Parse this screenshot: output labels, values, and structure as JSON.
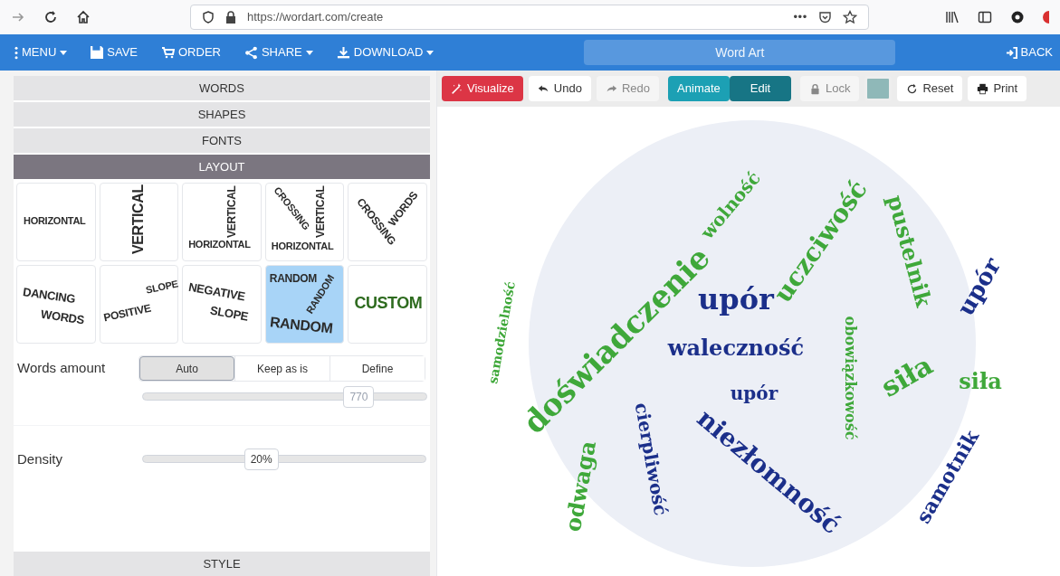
{
  "browser": {
    "url": "https://wordart.com/create",
    "more": "•••"
  },
  "nav": {
    "items": [
      {
        "label": "MENU",
        "caret": true
      },
      {
        "label": "SAVE",
        "caret": false
      },
      {
        "label": "ORDER",
        "caret": false
      },
      {
        "label": "SHARE",
        "caret": true
      },
      {
        "label": "DOWNLOAD",
        "caret": true
      }
    ],
    "title": "Word Art",
    "back": "BACK"
  },
  "sections": [
    {
      "label": "WORDS",
      "selected": false
    },
    {
      "label": "SHAPES",
      "selected": false
    },
    {
      "label": "FONTS",
      "selected": false
    },
    {
      "label": "LAYOUT",
      "selected": true
    }
  ],
  "layouts": [
    {
      "words": [
        "HORIZONTAL"
      ],
      "selected": false,
      "color": "#2b2b2b"
    },
    {
      "words": [
        "VERTICAL"
      ],
      "selected": false,
      "color": "#2b2b2b"
    },
    {
      "words": [
        "VERTICAL",
        "HORIZONTAL"
      ],
      "selected": false,
      "color": "#2b2b2b"
    },
    {
      "words": [
        "CROSSING",
        "VERTICAL",
        "HORIZONTAL"
      ],
      "selected": false,
      "color": "#2b2b2b"
    },
    {
      "words": [
        "CROSSING",
        "WORDS"
      ],
      "selected": false,
      "color": "#2b2b2b"
    },
    {
      "words": [
        "DANCING",
        "WORDS"
      ],
      "selected": false,
      "color": "#2b2b2b"
    },
    {
      "words": [
        "POSITIVE",
        "SLOPE"
      ],
      "selected": false,
      "color": "#2b2b2b"
    },
    {
      "words": [
        "NEGATIVE",
        "SLOPE"
      ],
      "selected": false,
      "color": "#2b2b2b"
    },
    {
      "words": [
        "RANDOM",
        "RANDOM",
        "RANDOM"
      ],
      "selected": true,
      "color": "#2b2b2b"
    },
    {
      "words": [
        "CUSTOM"
      ],
      "selected": false,
      "color": "#2e6b1f"
    }
  ],
  "words_amount": {
    "label": "Words amount",
    "options": [
      {
        "label": "Auto",
        "selected": true
      },
      {
        "label": "Keep as is",
        "selected": false
      },
      {
        "label": "Define",
        "selected": false
      }
    ],
    "slider": {
      "level": 0.76,
      "reading": "770",
      "disabled": true
    }
  },
  "density": {
    "label": "Density",
    "slider": {
      "level": 0.42,
      "reading": "20%",
      "disabled": false
    }
  },
  "style_section": {
    "label": "STYLE",
    "selected": false
  },
  "toolbar": [
    {
      "kind": "primary",
      "label": "Visualize"
    },
    {
      "kind": "plain",
      "label": "Undo",
      "disabled": false
    },
    {
      "kind": "plain",
      "label": "Redo",
      "disabled": true
    },
    {
      "kind": "toggle",
      "label": "Animate",
      "selected": false
    },
    {
      "kind": "toggle",
      "label": "Edit",
      "selected": true
    },
    {
      "kind": "plain",
      "label": "Lock",
      "disabled": true
    },
    {
      "kind": "swatch",
      "color": "#8fb8b8"
    },
    {
      "kind": "plain",
      "label": "Reset",
      "disabled": false
    },
    {
      "kind": "plain",
      "label": "Print",
      "disabled": false
    }
  ],
  "cloud_words": [
    {
      "text": "doświadczenie",
      "color": "#3fa83a"
    },
    {
      "text": "upór",
      "color": "#1b2f8a"
    },
    {
      "text": "waleczność",
      "color": "#1b2f8a"
    },
    {
      "text": "uczciwość",
      "color": "#3fa83a"
    },
    {
      "text": "pustelnik",
      "color": "#3fa83a"
    },
    {
      "text": "siła",
      "color": "#3fa83a"
    },
    {
      "text": "wolność",
      "color": "#3fa83a"
    },
    {
      "text": "niezłomność",
      "color": "#1b2f8a"
    },
    {
      "text": "cierpliwość",
      "color": "#1b2f8a"
    },
    {
      "text": "samotnik",
      "color": "#1b2f8a"
    },
    {
      "text": "odwaga",
      "color": "#3fa83a"
    },
    {
      "text": "obowiązkowość",
      "color": "#3fa83a"
    },
    {
      "text": "samodzielność",
      "color": "#3fa83a"
    },
    {
      "text": "upór",
      "color": "#1b2f8a"
    },
    {
      "text": "siła",
      "color": "#3fa83a"
    },
    {
      "text": "upór",
      "color": "#1b2f8a"
    }
  ]
}
